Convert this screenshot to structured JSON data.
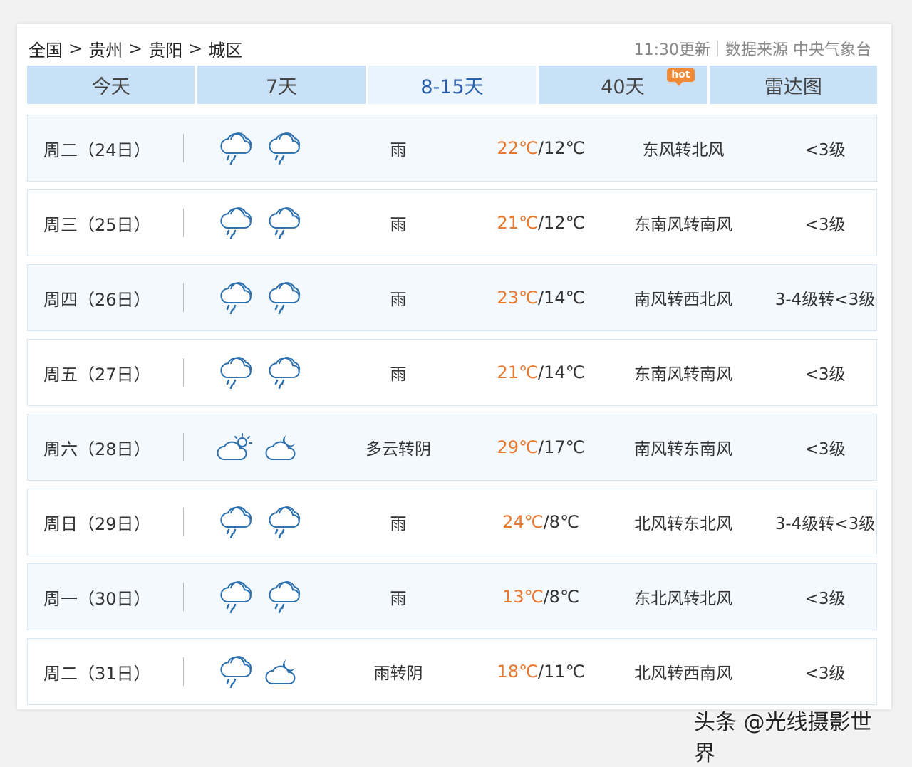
{
  "breadcrumb": {
    "items": [
      "全国",
      "贵州",
      "贵阳",
      "城区"
    ],
    "separator": ">"
  },
  "meta": {
    "updated": "11:30更新",
    "source": "数据来源 中央气象台"
  },
  "tabs": [
    {
      "label": "今天"
    },
    {
      "label": "7天"
    },
    {
      "label": "8-15天",
      "active": true
    },
    {
      "label": "40天",
      "badge": "hot"
    },
    {
      "label": "雷达图"
    }
  ],
  "colors": {
    "accent": "#2b5fae",
    "high_temp": "#e9782f",
    "tab_bg": "#c8e1f6",
    "hot_badge": "#f08a37"
  },
  "forecast": [
    {
      "day": "周二（24日）",
      "icon_day": "rain-cloud-icon",
      "icon_night": "rain-cloud-icon",
      "desc": "雨",
      "high": "22℃",
      "low": "12℃",
      "wind": "东风转北风",
      "level": "<3级"
    },
    {
      "day": "周三（25日）",
      "icon_day": "rain-cloud-icon",
      "icon_night": "rain-cloud-icon",
      "desc": "雨",
      "high": "21℃",
      "low": "12℃",
      "wind": "东南风转南风",
      "level": "<3级"
    },
    {
      "day": "周四（26日）",
      "icon_day": "rain-cloud-icon",
      "icon_night": "rain-cloud-icon",
      "desc": "雨",
      "high": "23℃",
      "low": "14℃",
      "wind": "南风转西北风",
      "level": "3-4级转<3级"
    },
    {
      "day": "周五（27日）",
      "icon_day": "rain-cloud-icon",
      "icon_night": "rain-cloud-icon",
      "desc": "雨",
      "high": "21℃",
      "low": "14℃",
      "wind": "东南风转南风",
      "level": "<3级"
    },
    {
      "day": "周六（28日）",
      "icon_day": "partly-cloudy-sun-icon",
      "icon_night": "cloudy-moon-icon",
      "desc": "多云转阴",
      "high": "29℃",
      "low": "17℃",
      "wind": "南风转东南风",
      "level": "<3级"
    },
    {
      "day": "周日（29日）",
      "icon_day": "rain-cloud-icon",
      "icon_night": "rain-cloud-icon",
      "desc": "雨",
      "high": "24℃",
      "low": "8℃",
      "wind": "北风转东北风",
      "level": "3-4级转<3级"
    },
    {
      "day": "周一（30日）",
      "icon_day": "rain-cloud-icon",
      "icon_night": "rain-cloud-icon",
      "desc": "雨",
      "high": "13℃",
      "low": "8℃",
      "wind": "东北风转北风",
      "level": "<3级"
    },
    {
      "day": "周二（31日）",
      "icon_day": "rain-cloud-icon",
      "icon_night": "cloudy-moon-icon",
      "desc": "雨转阴",
      "high": "18℃",
      "low": "11℃",
      "wind": "北风转西南风",
      "level": "<3级"
    }
  ],
  "watermark": "头条 @光线摄影世界"
}
